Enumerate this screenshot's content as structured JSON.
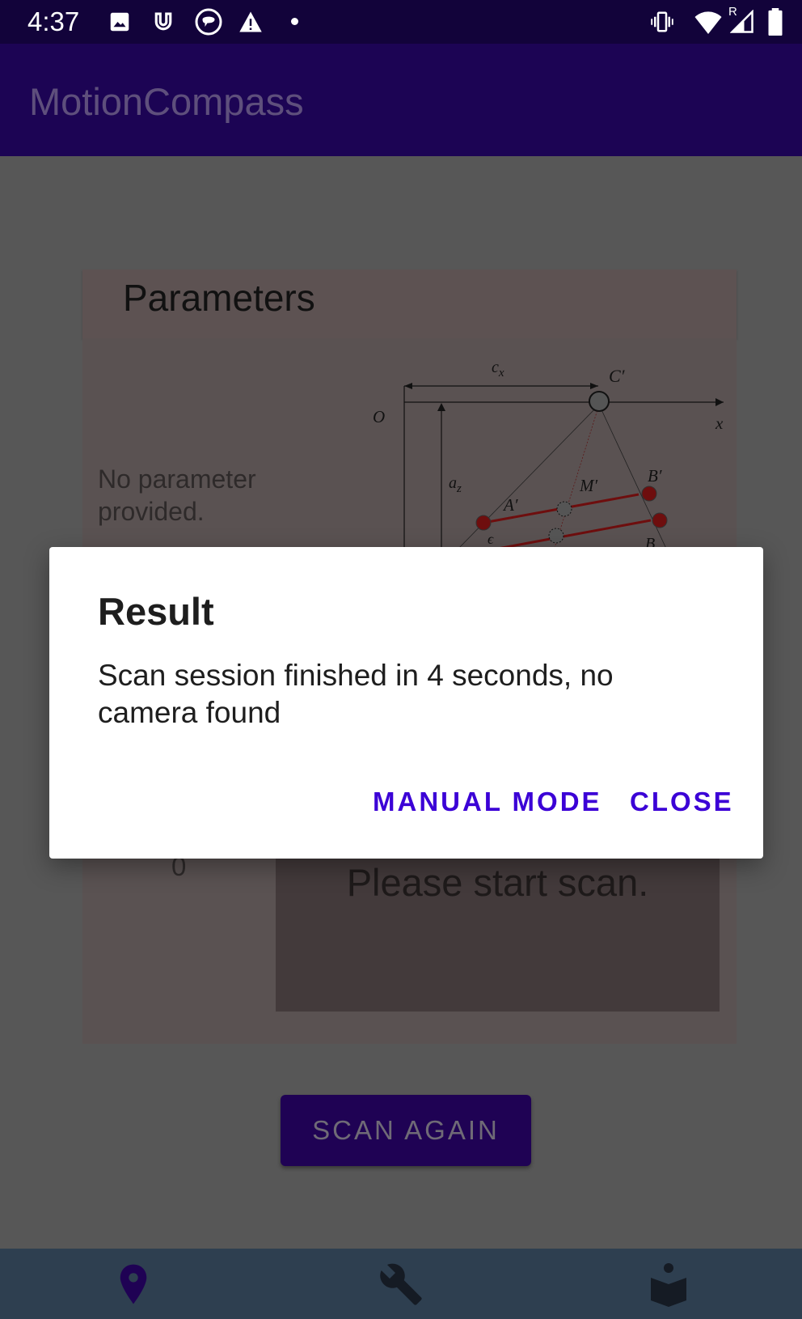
{
  "status_bar": {
    "time": "4:37",
    "left_icons": [
      "image-icon",
      "magnet-icon",
      "chat-bubble-icon",
      "warning-icon",
      "dot-icon"
    ],
    "right_icons": [
      "vibrate-icon",
      "wifi-icon",
      "signal-roaming-icon",
      "battery-icon"
    ],
    "roaming_label": "R"
  },
  "app_bar": {
    "title": "MotionCompass"
  },
  "parameters_card": {
    "title": "Parameters",
    "empty_text": "No parameter provided.",
    "diagram_labels": {
      "cx": "c",
      "cx_sub": "x",
      "c_prime": "C′",
      "origin": "O",
      "x_axis": "x",
      "az": "a",
      "az_sub": "z",
      "b_prime": "B′",
      "m_prime": "M′",
      "a_prime": "A′",
      "epsilon": "ϵ",
      "b": "B"
    }
  },
  "scan": {
    "count": "0",
    "message": "Please start scan.",
    "scan_again_label": "SCAN AGAIN"
  },
  "dialog": {
    "title": "Result",
    "message": "Scan session finished in 4 seconds, no camera found",
    "manual_mode_label": "MANUAL MODE",
    "close_label": "CLOSE",
    "accent_color": "#3b00d6"
  },
  "bottom_nav": {
    "items": [
      {
        "icon": "location-pin-icon",
        "active": true
      },
      {
        "icon": "wrench-icon",
        "active": false
      },
      {
        "icon": "reading-person-icon",
        "active": false
      }
    ]
  }
}
